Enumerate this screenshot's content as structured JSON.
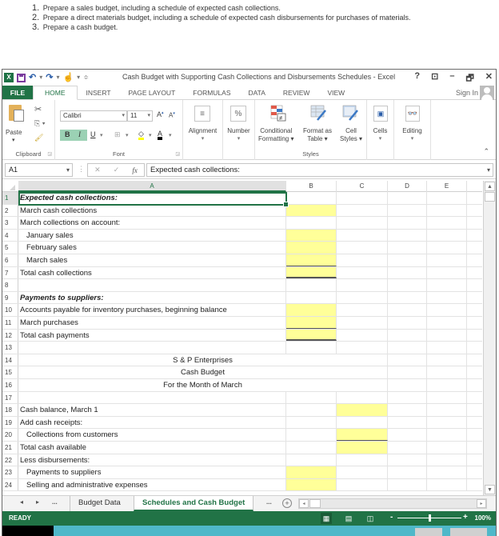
{
  "instructions": [
    {
      "num": "1.",
      "text": "Prepare a sales budget, including a schedule of expected cash collections."
    },
    {
      "num": "2.",
      "text": "Prepare a direct materials budget, including a schedule of expected cash disbursements for purchases of materials."
    },
    {
      "num": "3.",
      "text": "Prepare a cash budget."
    }
  ],
  "window": {
    "title": "Cash Budget with Supporting Cash Collections and Disbursements Schedules - Excel",
    "controls": [
      "?",
      "⊡",
      "–",
      "🗗",
      "✕"
    ],
    "sign_in": "Sign In"
  },
  "ribbon_tabs": [
    "FILE",
    "HOME",
    "INSERT",
    "PAGE LAYOUT",
    "FORMULAS",
    "DATA",
    "REVIEW",
    "VIEW"
  ],
  "ribbon": {
    "clipboard": {
      "paste": "Paste",
      "label": "Clipboard"
    },
    "font": {
      "name": "Calibri",
      "size": "11",
      "bold": "B",
      "italic": "I",
      "underline": "U",
      "label": "Font"
    },
    "alignment": "Alignment",
    "number": "Number",
    "number_icon": "%",
    "styles": {
      "conditional": "Conditional",
      "conditional2": "Formatting ▾",
      "format_table": "Format as",
      "format_table2": "Table ▾",
      "cell_styles": "Cell",
      "cell_styles2": "Styles ▾",
      "label": "Styles"
    },
    "cells": "Cells",
    "editing": "Editing"
  },
  "formula_bar": {
    "name_box": "A1",
    "fx": "fx",
    "formula": "Expected cash collections:"
  },
  "columns": [
    "A",
    "B",
    "C",
    "D",
    "E"
  ],
  "rows": [
    {
      "n": "1",
      "a": "Expected cash collections:"
    },
    {
      "n": "2",
      "a": "March cash collections"
    },
    {
      "n": "3",
      "a": "March collections on account:"
    },
    {
      "n": "4",
      "a": "January sales"
    },
    {
      "n": "5",
      "a": "February sales"
    },
    {
      "n": "6",
      "a": "March sales"
    },
    {
      "n": "7",
      "a": "Total cash collections"
    },
    {
      "n": "8",
      "a": ""
    },
    {
      "n": "9",
      "a": "Payments to suppliers:"
    },
    {
      "n": "10",
      "a": "Accounts payable for inventory purchases, beginning balance"
    },
    {
      "n": "11",
      "a": "March purchases"
    },
    {
      "n": "12",
      "a": "Total cash payments"
    },
    {
      "n": "13",
      "a": ""
    },
    {
      "n": "14",
      "a": "S & P Enterprises"
    },
    {
      "n": "15",
      "a": "Cash Budget"
    },
    {
      "n": "16",
      "a": "For the Month of March"
    },
    {
      "n": "17",
      "a": ""
    },
    {
      "n": "18",
      "a": "Cash balance, March 1"
    },
    {
      "n": "19",
      "a": "Add cash receipts:"
    },
    {
      "n": "20",
      "a": "Collections from customers"
    },
    {
      "n": "21",
      "a": "Total cash available"
    },
    {
      "n": "22",
      "a": "Less disbursements:"
    },
    {
      "n": "23",
      "a": "Payments to suppliers"
    },
    {
      "n": "24",
      "a": "Selling and administrative expenses"
    }
  ],
  "sheet_tabs": {
    "nav_prev": "◂",
    "nav_next": "▸",
    "ellipsis": "...",
    "tabs": [
      "Budget Data",
      "Schedules and Cash Budget"
    ],
    "active": "Schedules and Cash Budget",
    "more": "...",
    "add": "+"
  },
  "status_bar": {
    "state": "READY",
    "zoom": "100%",
    "zoom_level_percent": 100
  },
  "colors": {
    "excel_green": "#217346",
    "input_yellow": "#ffff99"
  }
}
